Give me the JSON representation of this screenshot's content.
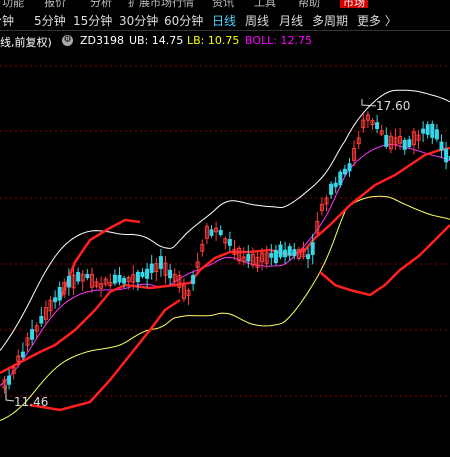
{
  "menu": {
    "items": [
      "功能",
      "报价",
      "分析",
      "扩展市场行情",
      "资讯",
      "工具",
      "帮助",
      "市场"
    ]
  },
  "periods": {
    "items": [
      "分钟",
      "5分钟",
      "15分钟",
      "30分钟",
      "60分钟",
      "日线",
      "周线",
      "月线",
      "多周期",
      "更多 〉"
    ],
    "active": "日线"
  },
  "indicator_bar": {
    "prefix": "线,前复权)",
    "indicator_name": "ZD3198",
    "ub_label": "UB: 14.75",
    "lb_label": "LB: 10.75",
    "boll_label": "BOLL: 12.75",
    "colors": {
      "ub": "#ffffff",
      "lb": "#ffff00",
      "boll": "#ff00ff",
      "name": "#ffffff",
      "prefix": "#ffffff"
    }
  },
  "chart": {
    "high_label": "17.60",
    "low_label": "11.46",
    "colors": {
      "up": "#ff3b3b",
      "down": "#35d8e8",
      "upper_band": "#ffffff",
      "lower_band": "#ffff66",
      "mid_band": "#ff33ff",
      "grid": "#8a0000",
      "thick": "#ff2020"
    }
  },
  "chart_data": {
    "type": "candlestick",
    "title": "",
    "high": 17.6,
    "low": 11.46,
    "indicators": {
      "UB": 14.75,
      "LB": 10.75,
      "BOLL": 12.75
    }
  }
}
